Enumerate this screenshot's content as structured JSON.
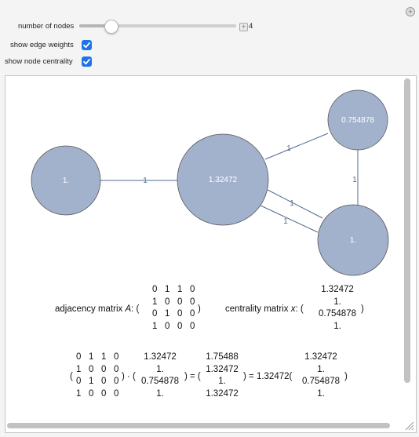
{
  "controls": {
    "nodes_label": "number of nodes",
    "nodes_value": "4",
    "nodes_fraction": 0.2,
    "plus_symbol": "+",
    "edge_weights_label": "show edge weights",
    "edge_weights_checked": true,
    "centrality_label": "show node centrality",
    "centrality_checked": true
  },
  "graph": {
    "node_fill": "#a3b2cc",
    "edge_color": "#4f6a93",
    "nodes": [
      {
        "id": "n0",
        "label": "1."
      },
      {
        "id": "n1",
        "label": "1.32472"
      },
      {
        "id": "n2",
        "label": "0.754878"
      },
      {
        "id": "n3",
        "label": "1."
      }
    ],
    "edge_labels": [
      "1",
      "1",
      "1",
      "1",
      "1"
    ]
  },
  "matrices": {
    "adjacency_label": "adjacency matrix",
    "adjacency_var": "A",
    "centrality_label": "centrality matrix",
    "centrality_var": "x",
    "A": [
      [
        "0",
        "1",
        "1",
        "0"
      ],
      [
        "1",
        "0",
        "0",
        "0"
      ],
      [
        "0",
        "1",
        "0",
        "0"
      ],
      [
        "1",
        "0",
        "0",
        "0"
      ]
    ],
    "x": [
      "1.32472",
      "1.",
      "0.754878",
      "1."
    ],
    "Ax": [
      "1.75488",
      "1.32472",
      "1.",
      "1.32472"
    ],
    "lambda": "1.32472"
  },
  "colors": {
    "accent": "#1e73e8"
  }
}
